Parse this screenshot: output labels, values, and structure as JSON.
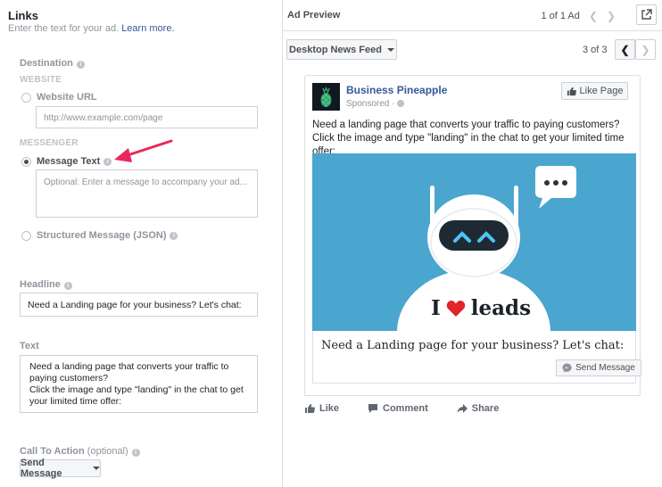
{
  "links": {
    "title": "Links",
    "subtitle": "Enter the text for your ad.",
    "learn_more": "Learn more.",
    "destination_label": "Destination",
    "website_heading": "WEBSITE",
    "website_url_label": "Website URL",
    "website_url_placeholder": "http://www.example.com/page",
    "messenger_heading": "MESSENGER",
    "message_text_label": "Message Text",
    "message_text_placeholder": "Optional: Enter a message to accompany your ad...",
    "structured_label": "Structured Message (JSON)",
    "headline_label": "Headline",
    "headline_value": "Need a Landing page for your business? Let's chat:",
    "text_label": "Text",
    "text_value_line1": "Need a landing page that converts your traffic to",
    "text_value_line2": "paying customers?",
    "text_value_line3": "Click the image and type \"landing\" in the chat to get",
    "text_value_line4": "your limited time offer:",
    "cta_label": "Call To Action",
    "cta_optional": "(optional)",
    "cta_value": "Send Message"
  },
  "preview": {
    "title": "Ad Preview",
    "ad_count": "1 of 1 Ad",
    "placement": "Desktop News Feed",
    "placement_count": "3 of 3"
  },
  "ad": {
    "page_name": "Business Pineapple",
    "sponsored": "Sponsored",
    "like_page": "Like Page",
    "body_line1": "Need a landing page that converts your traffic to paying customers?",
    "body_line2": "Click the image and type \"landing\" in the chat to get your limited time offer:",
    "image_text_i": "I",
    "image_text_leads": "leads",
    "headline": "Need a Landing page for your business? Let's chat:",
    "send_message": "Send Message",
    "actions": {
      "like": "Like",
      "comment": "Comment",
      "share": "Share"
    }
  },
  "colors": {
    "link": "#365899",
    "ad_image_bg": "#4aa6cf",
    "arrow": "#e8285a",
    "heart": "#e0242b"
  }
}
